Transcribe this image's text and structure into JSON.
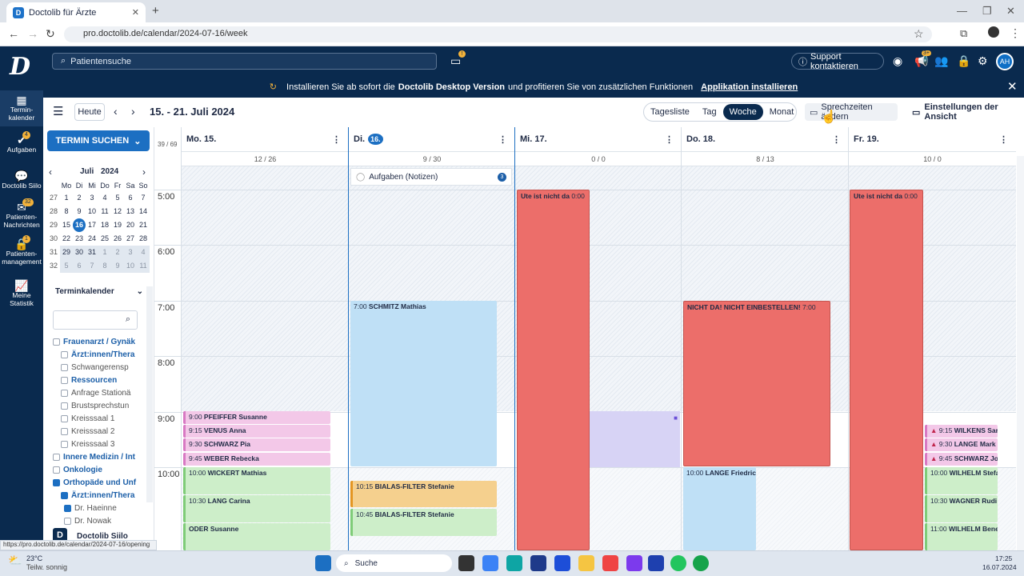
{
  "browser": {
    "tab_title": "Doctolib für Ärzte",
    "url": "pro.doctolib.de/calendar/2024-07-16/week",
    "status_url": "https://pro.doctolib.de/calendar/2024-07-16/opening"
  },
  "header": {
    "search_placeholder": "Patientensuche",
    "support": "Support kontaktieren",
    "avatar": "AH",
    "badge": "3+"
  },
  "banner": {
    "prefix": "Installieren Sie ab sofort die",
    "bold": "Doctolib Desktop Version",
    "suffix": "und profitieren Sie von zusätzlichen Funktionen",
    "link": "Applikation installieren"
  },
  "sidebar": [
    {
      "label": "Termin-kalender",
      "icon": "calendar-icon"
    },
    {
      "label": "Aufgaben",
      "icon": "check-icon",
      "badge": "4"
    },
    {
      "label": "Doctolib Siilo",
      "icon": "chat-icon"
    },
    {
      "label": "Patienten-Nachrichten",
      "icon": "message-icon",
      "badge": "32"
    },
    {
      "label": "Patienten-management",
      "icon": "lock-icon",
      "badge": "1"
    },
    {
      "label": "Meine Statistik",
      "icon": "chart-icon"
    }
  ],
  "toolbar": {
    "today": "Heute",
    "range": "15. - 21. Juli 2024",
    "views": [
      "Tagesliste",
      "Tag",
      "Woche",
      "Monat"
    ],
    "active_view": "Woche",
    "hours_button": "Sprechzeiten ändern",
    "settings_button": "Einstellungen der Ansicht"
  },
  "left": {
    "search_button": "TERMIN SUCHEN",
    "month": "Juli",
    "year": "2024",
    "weekdays": [
      "Mo",
      "Di",
      "Mi",
      "Do",
      "Fr",
      "Sa",
      "So"
    ],
    "weeks": [
      [
        "27",
        "1",
        "2",
        "3",
        "4",
        "5",
        "6",
        "7"
      ],
      [
        "28",
        "8",
        "9",
        "10",
        "11",
        "12",
        "13",
        "14"
      ],
      [
        "29",
        "15",
        "16",
        "17",
        "18",
        "19",
        "20",
        "21"
      ],
      [
        "30",
        "22",
        "23",
        "24",
        "25",
        "26",
        "27",
        "28"
      ],
      [
        "31",
        "29",
        "30",
        "31",
        "1",
        "2",
        "3",
        "4"
      ],
      [
        "32",
        "5",
        "6",
        "7",
        "8",
        "9",
        "10",
        "11"
      ]
    ],
    "calendar_title": "Terminkalender",
    "tree": [
      "Frauenarzt / Gynäk",
      "Ärzt:innen/Thera",
      "Schwangerensp",
      "Ressourcen",
      "Anfrage Stationä",
      "Brustsprechstun",
      "Kreisssaal 1",
      "Kreisssaal 2",
      "Kreisssaal 3",
      "Innere Medizin / Int",
      "Onkologie",
      "Orthopäde und Unf",
      "Ärzt:innen/Thera",
      "Dr. Haeinne",
      "Dr. Nowak"
    ],
    "siilo": "Doctolib Siilo"
  },
  "calendar": {
    "week_count": "39 / 69",
    "days": [
      {
        "label": "Mo. 15.",
        "count": "12 / 26"
      },
      {
        "label": "Di.",
        "num": "16.",
        "count": "9 / 30"
      },
      {
        "label": "Mi. 17.",
        "count": "0 / 0"
      },
      {
        "label": "Do. 18.",
        "count": "8 / 13"
      },
      {
        "label": "Fr. 19.",
        "count": "10 / 0"
      }
    ],
    "times": [
      "5:00",
      "6:00",
      "7:00",
      "8:00",
      "9:00",
      "10:00"
    ],
    "tasks": {
      "label": "Aufgaben (Notizen)",
      "count": "3"
    },
    "events": [
      {
        "t": "9:00",
        "n": "PFEIFFER Susanne"
      },
      {
        "t": "9:15",
        "n": "VENUS Anna"
      },
      {
        "t": "9:30",
        "n": "SCHWARZ Pia"
      },
      {
        "t": "9:45",
        "n": "WEBER Rebecka"
      },
      {
        "t": "10:00",
        "n": "WICKERT Mathias"
      },
      {
        "t": "10:30",
        "n": "LANG Carina"
      },
      {
        "t": "",
        "n": "ODER Susanne"
      },
      {
        "t": "7:00",
        "n": "SCHMITZ Mathias"
      },
      {
        "t": "10:15",
        "n": "BIALAS-FILTER Stefanie"
      },
      {
        "t": "10:45",
        "n": "BIALAS-FILTER Stefanie"
      },
      {
        "t": "0:00",
        "n": "Ute ist nicht da"
      },
      {
        "t": "7:00",
        "n": "NICHT DA! NICHT EINBESTELLEN!"
      },
      {
        "t": "10:00",
        "n": "LANGE Friedrich"
      },
      {
        "t": "0:00",
        "n": "Ute ist nicht da"
      },
      {
        "t": "9:15",
        "n": "WILKENS Sarah"
      },
      {
        "t": "9:30",
        "n": "LANGE Mark"
      },
      {
        "t": "9:45",
        "n": "SCHWARZ Josef"
      },
      {
        "t": "10:00",
        "n": "WILHELM Stefa"
      },
      {
        "t": "10:30",
        "n": "WAGNER Rudi"
      },
      {
        "t": "11:00",
        "n": "WILHELM Bene"
      }
    ]
  },
  "taskbar": {
    "temp": "23°C",
    "weather": "Teilw. sonnig",
    "search": "Suche",
    "time": "17:25",
    "date": "16.07.2024"
  },
  "colors": {
    "navy": "#0a2a4e",
    "accent": "#1c6fc2",
    "red_event": "#ec6e6a",
    "blue_event": "#bfe0f6"
  }
}
